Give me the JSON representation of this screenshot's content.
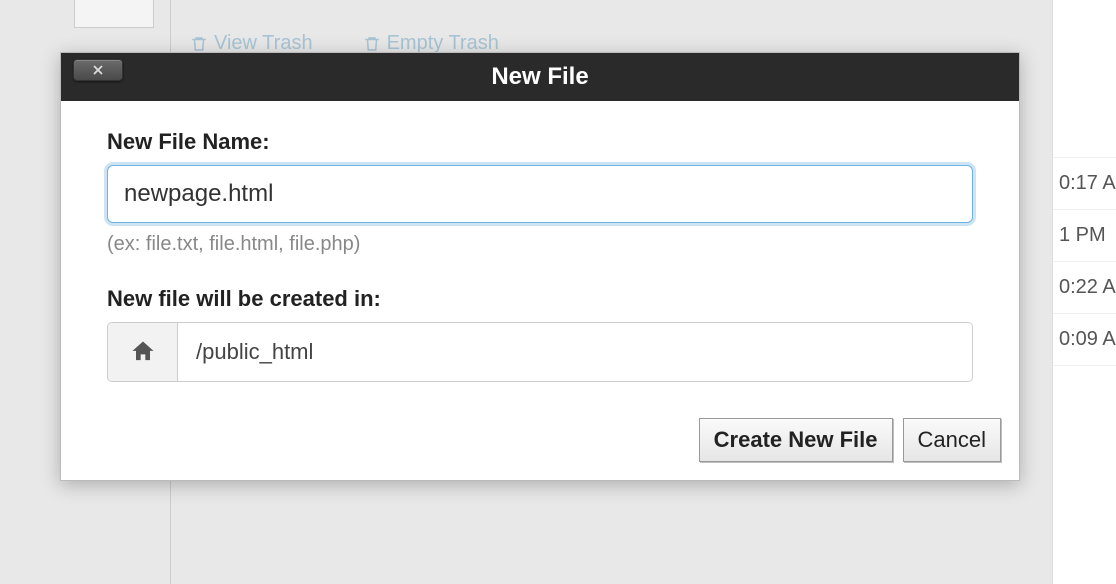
{
  "background": {
    "toolbar": {
      "view_trash": "View Trash",
      "empty_trash": "Empty Trash"
    },
    "times": [
      "0:17 A",
      "1 PM",
      "0:22 A",
      "0:09 A"
    ]
  },
  "modal": {
    "title": "New File",
    "filename_label": "New File Name:",
    "filename_value": "newpage.html",
    "filename_hint": "(ex: file.txt, file.html, file.php)",
    "location_label": "New file will be created in:",
    "location_path": "/public_html",
    "create_button": "Create New File",
    "cancel_button": "Cancel"
  }
}
